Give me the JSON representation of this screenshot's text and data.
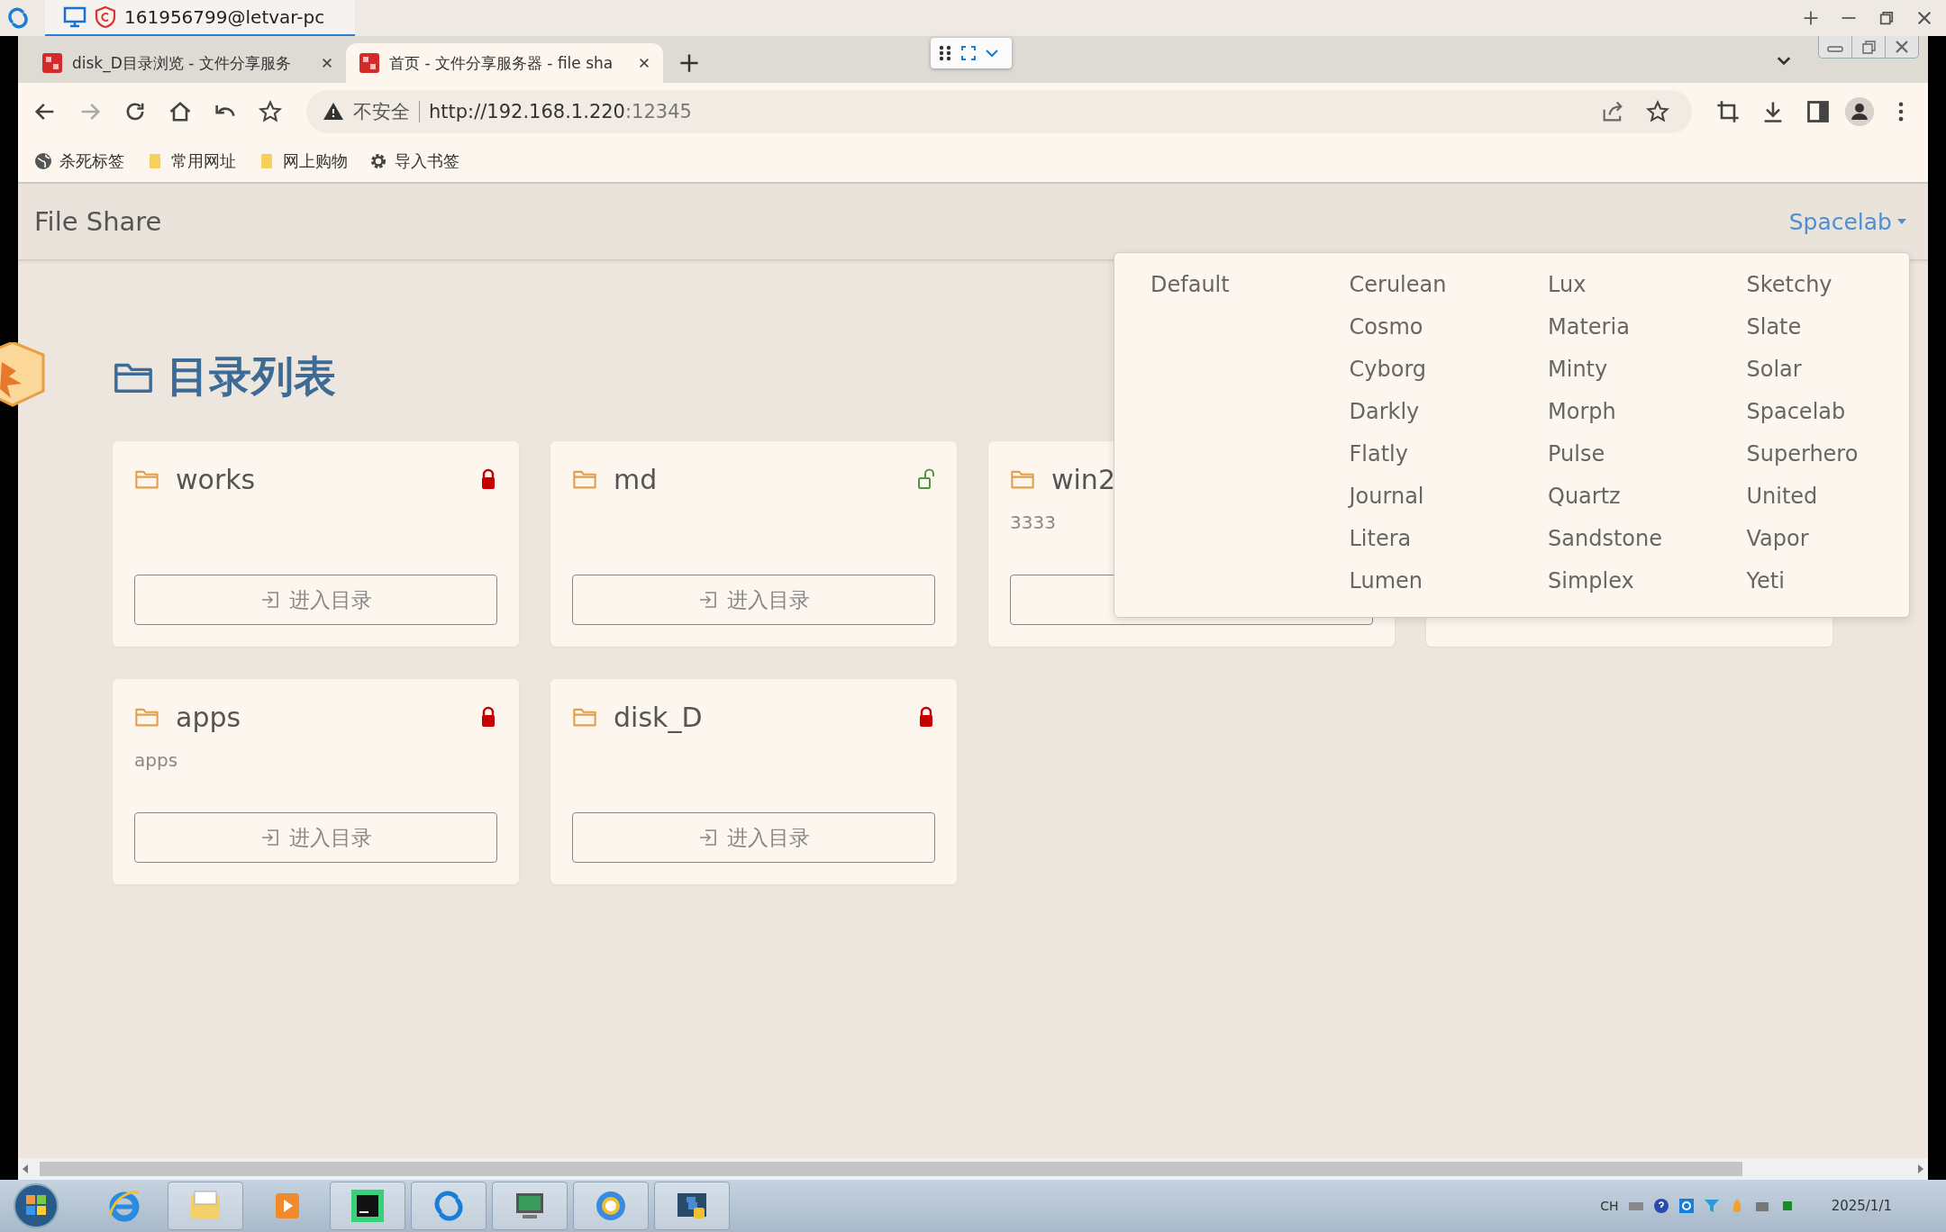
{
  "remote_window": {
    "title": "161956799@letvar-pc"
  },
  "browser": {
    "tabs": [
      {
        "title": "disk_D目录浏览 - 文件分享服务",
        "selected": false
      },
      {
        "title": "首页 - 文件分享服务器 - file sha",
        "selected": true
      }
    ],
    "address": {
      "security": "不安全",
      "host": "http://192.168.1.220",
      "port": ":12345"
    },
    "bookmarks": [
      {
        "kind": "globe",
        "label": "杀死标签"
      },
      {
        "kind": "folder",
        "label": "常用网址"
      },
      {
        "kind": "folder",
        "label": "网上购物"
      },
      {
        "kind": "gear",
        "label": "导入书签"
      }
    ]
  },
  "page": {
    "brand": "File Share",
    "theme_menu": {
      "label": "Spacelab",
      "expanded": true,
      "columns": [
        [
          "Default"
        ],
        [
          "Cerulean",
          "Cosmo",
          "Cyborg",
          "Darkly",
          "Flatly",
          "Journal",
          "Litera",
          "Lumen"
        ],
        [
          "Lux",
          "Materia",
          "Minty",
          "Morph",
          "Pulse",
          "Quartz",
          "Sandstone",
          "Simplex"
        ],
        [
          "Sketchy",
          "Slate",
          "Solar",
          "Spacelab",
          "Superhero",
          "United",
          "Vapor",
          "Yeti"
        ]
      ]
    },
    "heading": "目录列表",
    "cards": [
      {
        "kind": "folder",
        "name": "works",
        "locked": true,
        "button": "进入目录"
      },
      {
        "kind": "folder",
        "name": "md",
        "locked": false,
        "button": "进入目录"
      },
      {
        "kind": "folder",
        "name": "win2",
        "description": "3333"
      },
      {
        "kind": "covered"
      },
      {
        "kind": "folder",
        "name": "apps",
        "locked": true,
        "description": "apps",
        "button": "进入目录"
      },
      {
        "kind": "folder",
        "name": "disk_D",
        "locked": true,
        "button": "进入目录"
      }
    ]
  },
  "taskbar": {
    "language": "CH",
    "date": "2025/1/1"
  }
}
